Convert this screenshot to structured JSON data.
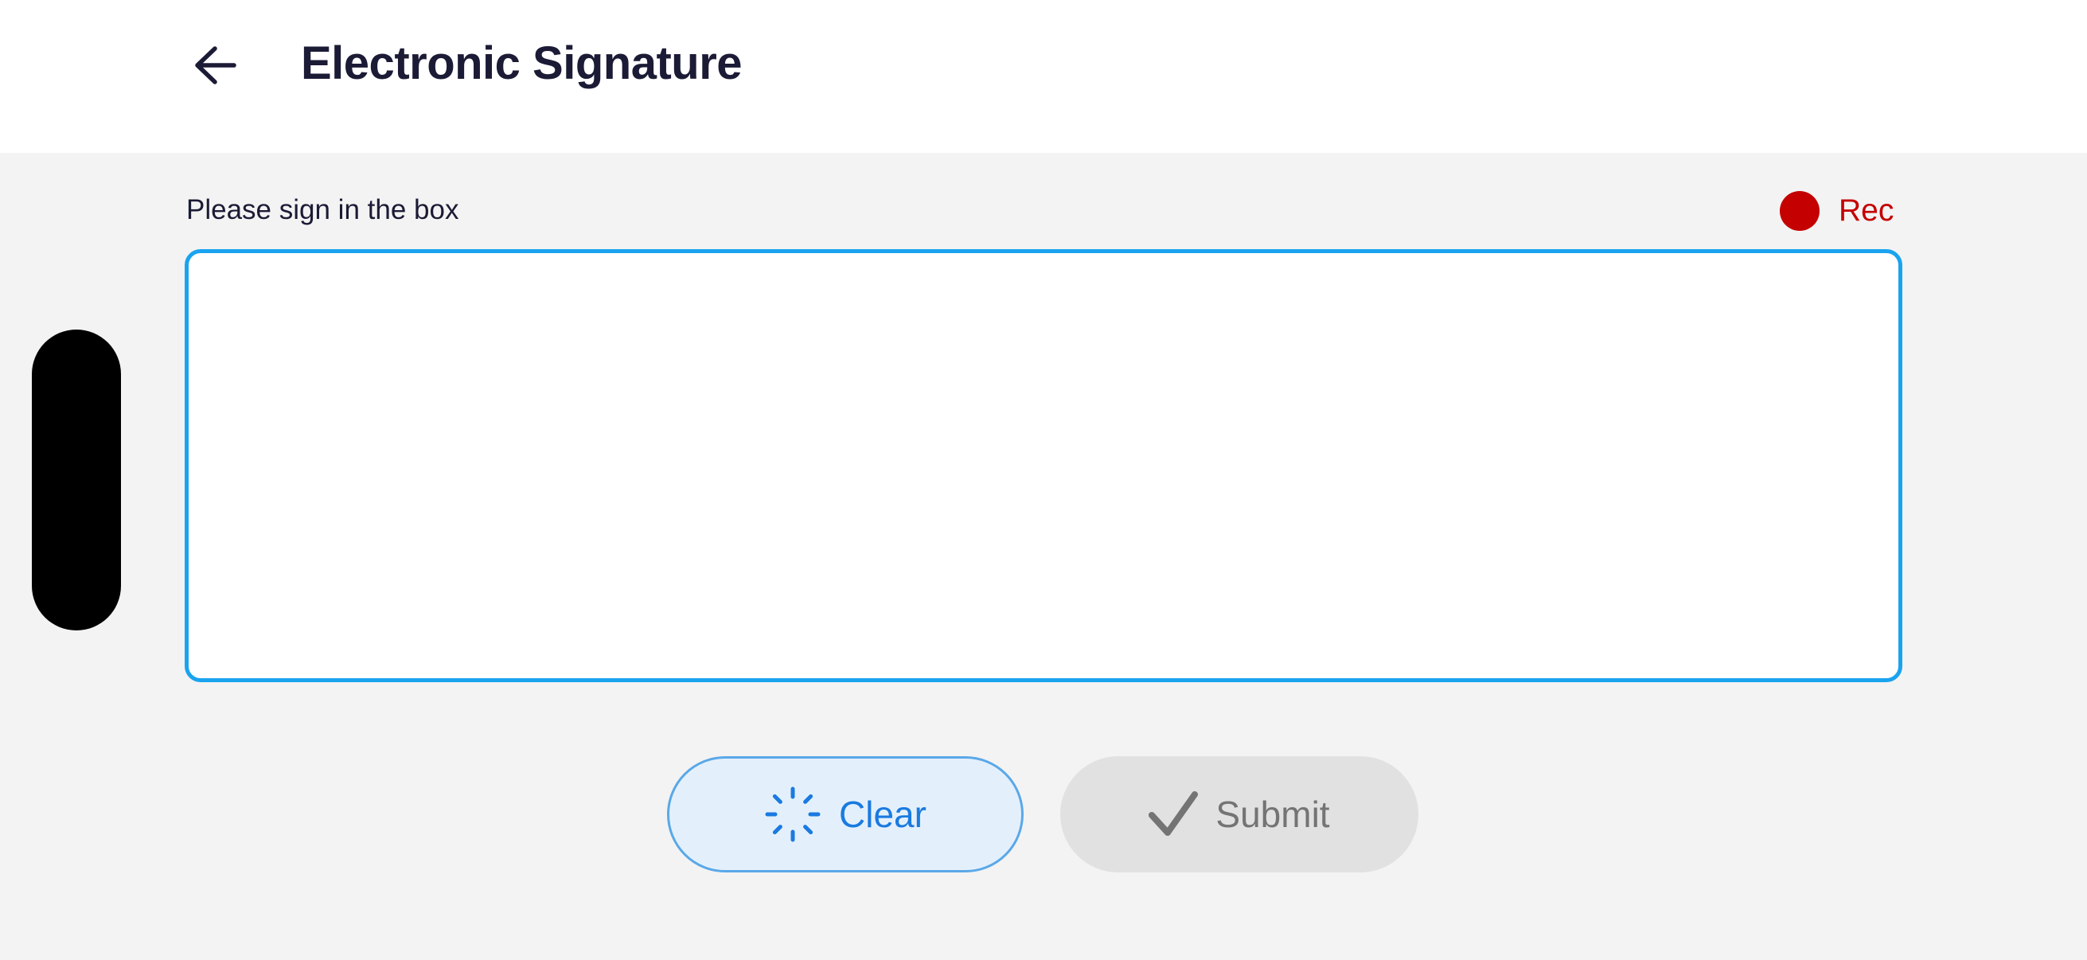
{
  "header": {
    "title": "Electronic Signature",
    "back_icon": "arrow-left-icon"
  },
  "signature": {
    "instruction": "Please sign in the box",
    "recording_label": "Rec",
    "recording_color": "#c40000",
    "box_border_color": "#1aa3ef"
  },
  "actions": {
    "clear_label": "Clear",
    "clear_icon": "spinner-icon",
    "clear_color": "#1a7ae0",
    "submit_label": "Submit",
    "submit_icon": "checkmark-icon",
    "submit_color": "#747474"
  }
}
